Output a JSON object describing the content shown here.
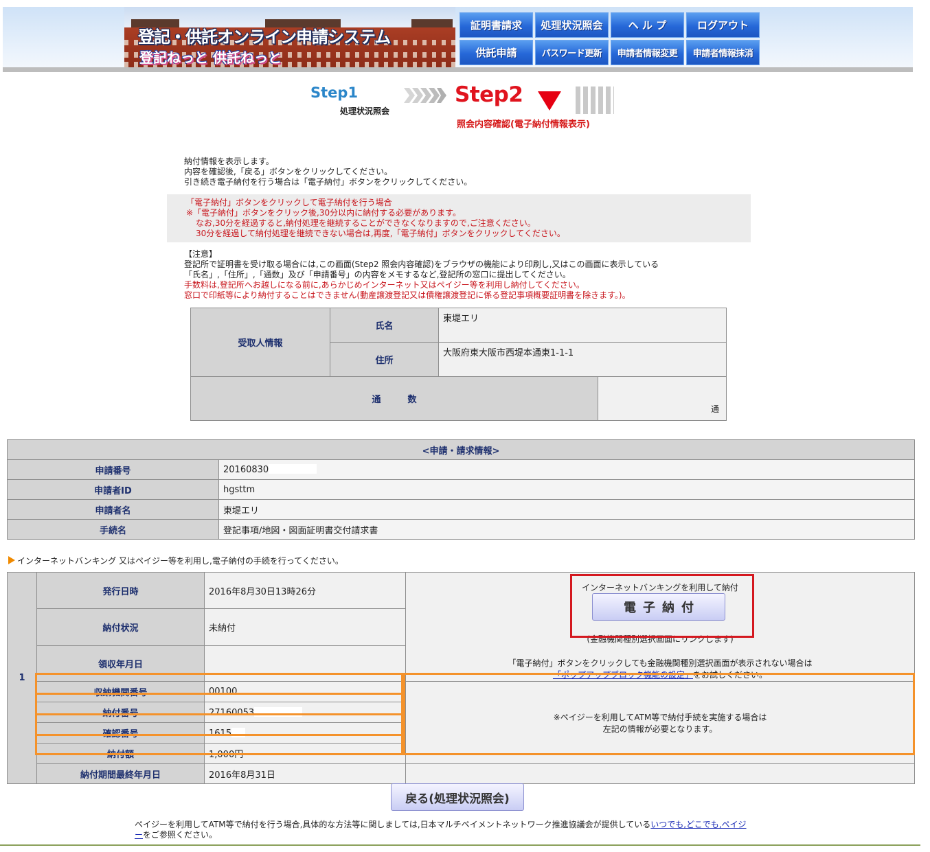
{
  "header": {
    "logo_title": "登記・供託オンライン申請システム",
    "logo_subtitle": "登記ねっと 供託ねっと",
    "nav_top": [
      "証明書請求",
      "処理状況照会",
      "ヘ ル プ",
      "ログアウト"
    ],
    "nav_bottom": [
      "供託申請",
      "パスワード更新",
      "申請者情報変更",
      "申請者情報抹消"
    ]
  },
  "steps": {
    "step1": "Step1",
    "step1_label": "処理状況照会",
    "step2": "Step2",
    "step2_label": "照会内容確認(電子納付情報表示)"
  },
  "intro": [
    "納付情報を表示します。",
    "内容を確認後,「戻る」ボタンをクリックしてください。",
    "引き続き電子納付を行う場合は「電子納付」ボタンをクリックしてください。"
  ],
  "notice": [
    "「電子納付」ボタンをクリックして電子納付を行う場合",
    "※「電子納付」ボタンをクリック後,30分以内に納付する必要があります。",
    "なお,30分を経過すると,納付処理を継続することができなくなりますので,ご注意ください。",
    "30分を経過して納付処理を継続できない場合は,再度,「電子納付」ボタンをクリックしてください。"
  ],
  "caution": {
    "heading": "【注意】",
    "lines": [
      "登記所で証明書を受け取る場合には,この画面(Step2 照会内容確認)をブラウザの機能により印刷し,又はこの画面に表示している",
      "「氏名」,「住所」,「通数」及び「申請番号」の内容をメモするなど,登記所の窓口に提出してください。"
    ],
    "red_lines": [
      "手数料は,登記所へお越しになる前に,あらかじめインターネット又はペイジー等を利用し納付してください。",
      "窓口で印紙等により納付することはできません(動産譲渡登記又は債権譲渡登記に係る登記事項概要証明書を除きます。)。"
    ]
  },
  "recipient": {
    "section_label": "受取人情報",
    "name_label": "氏名",
    "name_value": "東堤エリ",
    "address_label": "住所",
    "address_value": "大阪府東大阪市西堤本通東1-1-1",
    "count_label": "通　　　数",
    "count_unit": "通"
  },
  "application": {
    "caption": "<申請・請求情報>",
    "rows": [
      {
        "label": "申請番号",
        "value": "20160830"
      },
      {
        "label": "申請者ID",
        "value": "hgsttm"
      },
      {
        "label": "申請者名",
        "value": "東堤エリ"
      },
      {
        "label": "手続名",
        "value": "登記事項/地図・図面証明書交付請求書"
      }
    ]
  },
  "payment": {
    "note": "インターネットバンキング 又はペイジー等を利用し,電子納付の手続を行ってください。",
    "row_number": "1",
    "rows": [
      {
        "label": "発行日時",
        "value": "2016年8月30日13時26分"
      },
      {
        "label": "納付状況",
        "value": "未納付"
      },
      {
        "label": "領収年月日",
        "value": ""
      },
      {
        "label": "収納機関番号",
        "value": "00100"
      },
      {
        "label": "納付番号",
        "value": "27160053"
      },
      {
        "label": "確認番号",
        "value": "1615"
      },
      {
        "label": "納付額",
        "value": "1,000円"
      },
      {
        "label": "納付期間最終年月日",
        "value": "2016年8月31日"
      }
    ],
    "ib_label": "インターネットバンキングを利用して納付",
    "pay_button": "電子納付",
    "ib_link_note": "(金融機関種別選択画面にリンクします)",
    "popup_text": "「電子納付」ボタンをクリックしても金融機関種別選択画面が表示されない場合は",
    "popup_link": "「ポップアップブロック機能の設定」",
    "popup_suffix": "をお試しください。",
    "payeasy_note_1": "※ペイジーを利用してATM等で納付手続を実施する場合は",
    "payeasy_note_2": "左記の情報が必要となります。"
  },
  "back_button": "戻る(処理状況照会)",
  "footer": {
    "text": "ペイジーを利用してATM等で納付を行う場合,具体的な方法等に関しましては,日本マルチペイメントネットワーク推進協議会が提供している",
    "link_1": "いつでも,どこでも,ペイジ",
    "link_2": "ー",
    "suffix": "をご参照ください。"
  }
}
